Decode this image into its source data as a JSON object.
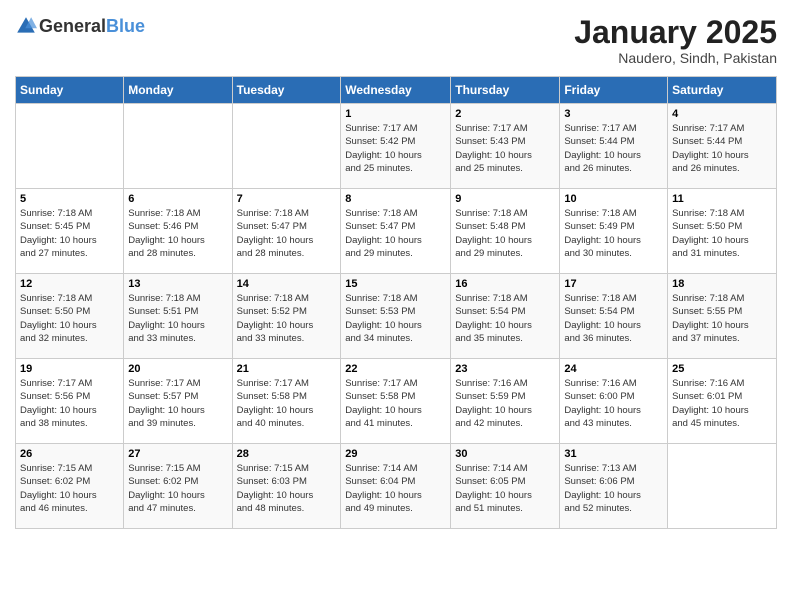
{
  "header": {
    "logo": {
      "general": "General",
      "blue": "Blue"
    },
    "title": "January 2025",
    "location": "Naudero, Sindh, Pakistan"
  },
  "weekdays": [
    "Sunday",
    "Monday",
    "Tuesday",
    "Wednesday",
    "Thursday",
    "Friday",
    "Saturday"
  ],
  "weeks": [
    [
      {
        "day": "",
        "info": ""
      },
      {
        "day": "",
        "info": ""
      },
      {
        "day": "",
        "info": ""
      },
      {
        "day": "1",
        "info": "Sunrise: 7:17 AM\nSunset: 5:42 PM\nDaylight: 10 hours\nand 25 minutes."
      },
      {
        "day": "2",
        "info": "Sunrise: 7:17 AM\nSunset: 5:43 PM\nDaylight: 10 hours\nand 25 minutes."
      },
      {
        "day": "3",
        "info": "Sunrise: 7:17 AM\nSunset: 5:44 PM\nDaylight: 10 hours\nand 26 minutes."
      },
      {
        "day": "4",
        "info": "Sunrise: 7:17 AM\nSunset: 5:44 PM\nDaylight: 10 hours\nand 26 minutes."
      }
    ],
    [
      {
        "day": "5",
        "info": "Sunrise: 7:18 AM\nSunset: 5:45 PM\nDaylight: 10 hours\nand 27 minutes."
      },
      {
        "day": "6",
        "info": "Sunrise: 7:18 AM\nSunset: 5:46 PM\nDaylight: 10 hours\nand 28 minutes."
      },
      {
        "day": "7",
        "info": "Sunrise: 7:18 AM\nSunset: 5:47 PM\nDaylight: 10 hours\nand 28 minutes."
      },
      {
        "day": "8",
        "info": "Sunrise: 7:18 AM\nSunset: 5:47 PM\nDaylight: 10 hours\nand 29 minutes."
      },
      {
        "day": "9",
        "info": "Sunrise: 7:18 AM\nSunset: 5:48 PM\nDaylight: 10 hours\nand 29 minutes."
      },
      {
        "day": "10",
        "info": "Sunrise: 7:18 AM\nSunset: 5:49 PM\nDaylight: 10 hours\nand 30 minutes."
      },
      {
        "day": "11",
        "info": "Sunrise: 7:18 AM\nSunset: 5:50 PM\nDaylight: 10 hours\nand 31 minutes."
      }
    ],
    [
      {
        "day": "12",
        "info": "Sunrise: 7:18 AM\nSunset: 5:50 PM\nDaylight: 10 hours\nand 32 minutes."
      },
      {
        "day": "13",
        "info": "Sunrise: 7:18 AM\nSunset: 5:51 PM\nDaylight: 10 hours\nand 33 minutes."
      },
      {
        "day": "14",
        "info": "Sunrise: 7:18 AM\nSunset: 5:52 PM\nDaylight: 10 hours\nand 33 minutes."
      },
      {
        "day": "15",
        "info": "Sunrise: 7:18 AM\nSunset: 5:53 PM\nDaylight: 10 hours\nand 34 minutes."
      },
      {
        "day": "16",
        "info": "Sunrise: 7:18 AM\nSunset: 5:54 PM\nDaylight: 10 hours\nand 35 minutes."
      },
      {
        "day": "17",
        "info": "Sunrise: 7:18 AM\nSunset: 5:54 PM\nDaylight: 10 hours\nand 36 minutes."
      },
      {
        "day": "18",
        "info": "Sunrise: 7:18 AM\nSunset: 5:55 PM\nDaylight: 10 hours\nand 37 minutes."
      }
    ],
    [
      {
        "day": "19",
        "info": "Sunrise: 7:17 AM\nSunset: 5:56 PM\nDaylight: 10 hours\nand 38 minutes."
      },
      {
        "day": "20",
        "info": "Sunrise: 7:17 AM\nSunset: 5:57 PM\nDaylight: 10 hours\nand 39 minutes."
      },
      {
        "day": "21",
        "info": "Sunrise: 7:17 AM\nSunset: 5:58 PM\nDaylight: 10 hours\nand 40 minutes."
      },
      {
        "day": "22",
        "info": "Sunrise: 7:17 AM\nSunset: 5:58 PM\nDaylight: 10 hours\nand 41 minutes."
      },
      {
        "day": "23",
        "info": "Sunrise: 7:16 AM\nSunset: 5:59 PM\nDaylight: 10 hours\nand 42 minutes."
      },
      {
        "day": "24",
        "info": "Sunrise: 7:16 AM\nSunset: 6:00 PM\nDaylight: 10 hours\nand 43 minutes."
      },
      {
        "day": "25",
        "info": "Sunrise: 7:16 AM\nSunset: 6:01 PM\nDaylight: 10 hours\nand 45 minutes."
      }
    ],
    [
      {
        "day": "26",
        "info": "Sunrise: 7:15 AM\nSunset: 6:02 PM\nDaylight: 10 hours\nand 46 minutes."
      },
      {
        "day": "27",
        "info": "Sunrise: 7:15 AM\nSunset: 6:02 PM\nDaylight: 10 hours\nand 47 minutes."
      },
      {
        "day": "28",
        "info": "Sunrise: 7:15 AM\nSunset: 6:03 PM\nDaylight: 10 hours\nand 48 minutes."
      },
      {
        "day": "29",
        "info": "Sunrise: 7:14 AM\nSunset: 6:04 PM\nDaylight: 10 hours\nand 49 minutes."
      },
      {
        "day": "30",
        "info": "Sunrise: 7:14 AM\nSunset: 6:05 PM\nDaylight: 10 hours\nand 51 minutes."
      },
      {
        "day": "31",
        "info": "Sunrise: 7:13 AM\nSunset: 6:06 PM\nDaylight: 10 hours\nand 52 minutes."
      },
      {
        "day": "",
        "info": ""
      }
    ]
  ]
}
